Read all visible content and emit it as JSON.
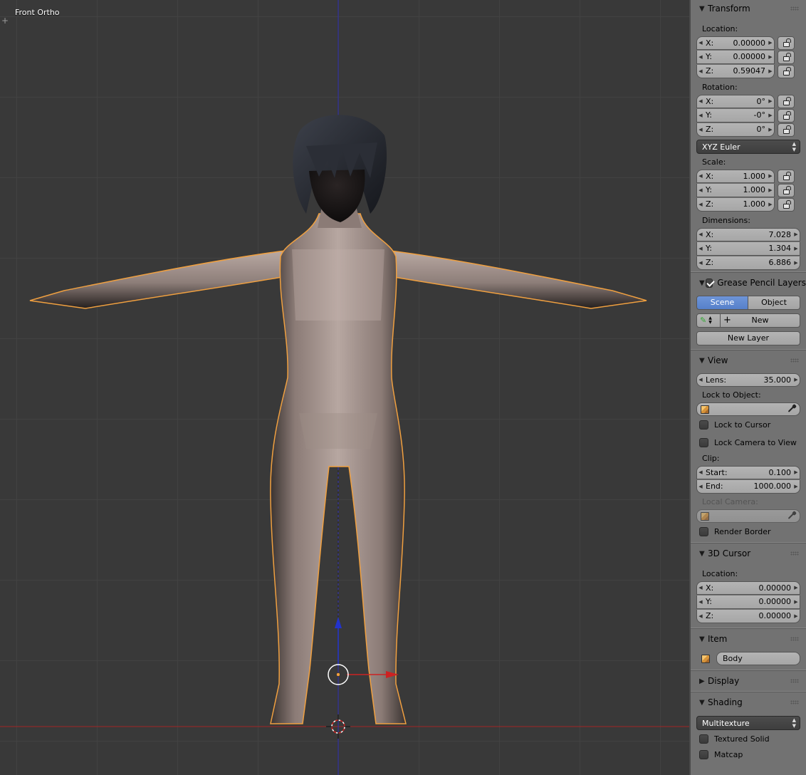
{
  "viewport": {
    "label": "Front Ortho",
    "corner_icon": "plus-icon"
  },
  "transform": {
    "title": "Transform",
    "location_label": "Location:",
    "location": [
      {
        "axis": "X:",
        "value": "0.00000"
      },
      {
        "axis": "Y:",
        "value": "0.00000"
      },
      {
        "axis": "Z:",
        "value": "0.59047"
      }
    ],
    "rotation_label": "Rotation:",
    "rotation": [
      {
        "axis": "X:",
        "value": "0°"
      },
      {
        "axis": "Y:",
        "value": "-0°"
      },
      {
        "axis": "Z:",
        "value": "0°"
      }
    ],
    "rotation_mode": "XYZ Euler",
    "scale_label": "Scale:",
    "scale": [
      {
        "axis": "X:",
        "value": "1.000"
      },
      {
        "axis": "Y:",
        "value": "1.000"
      },
      {
        "axis": "Z:",
        "value": "1.000"
      }
    ],
    "dimensions_label": "Dimensions:",
    "dimensions": [
      {
        "axis": "X:",
        "value": "7.028"
      },
      {
        "axis": "Y:",
        "value": "1.304"
      },
      {
        "axis": "Z:",
        "value": "6.886"
      }
    ]
  },
  "grease_pencil": {
    "title": "Grease Pencil Layers",
    "enabled": true,
    "tab_scene": "Scene",
    "tab_object": "Object",
    "active_tab": "Scene",
    "new_label": "New",
    "new_layer_label": "New Layer"
  },
  "view": {
    "title": "View",
    "lens_label": "Lens:",
    "lens_value": "35.000",
    "lock_to_object_label": "Lock to Object:",
    "lock_to_cursor_label": "Lock to Cursor",
    "lock_camera_label": "Lock Camera to View",
    "clip_label": "Clip:",
    "clip_start_label": "Start:",
    "clip_start_value": "0.100",
    "clip_end_label": "End:",
    "clip_end_value": "1000.000",
    "local_camera_label": "Local Camera:",
    "render_border_label": "Render Border"
  },
  "cursor": {
    "title": "3D Cursor",
    "location_label": "Location:",
    "location": [
      {
        "axis": "X:",
        "value": "0.00000"
      },
      {
        "axis": "Y:",
        "value": "0.00000"
      },
      {
        "axis": "Z:",
        "value": "0.00000"
      }
    ]
  },
  "item": {
    "title": "Item",
    "name": "Body"
  },
  "display": {
    "title": "Display"
  },
  "shading": {
    "title": "Shading",
    "mode": "Multitexture",
    "textured_solid_label": "Textured Solid",
    "matcap_label": "Matcap"
  },
  "colors": {
    "viewport_bg": "#393939",
    "panel_bg": "#727272",
    "active_tab": "#5680ca",
    "selection_outline": "#f0a040",
    "x_axis": "#cc2222",
    "z_axis": "#2233cc"
  }
}
